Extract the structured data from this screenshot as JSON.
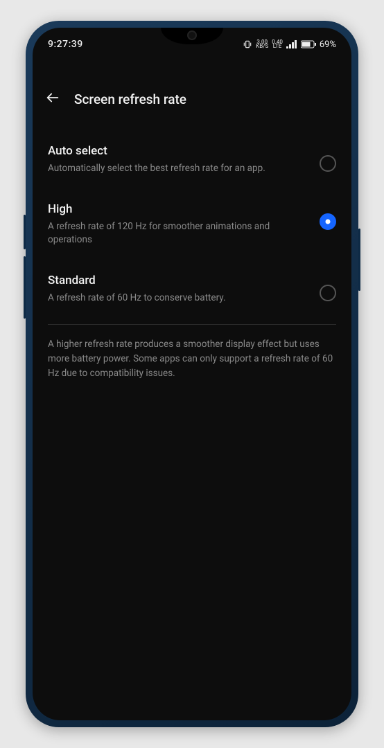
{
  "status": {
    "time": "9:27:39",
    "data_rate_value": "3.00",
    "data_rate_unit": "KB/S",
    "net_hint_top": "0.40",
    "net_hint_bottom": "LTE",
    "battery_pct": "69%"
  },
  "header": {
    "title": "Screen refresh rate"
  },
  "options": [
    {
      "id": "auto",
      "title": "Auto select",
      "desc": "Automatically select the best refresh rate for an app.",
      "selected": false
    },
    {
      "id": "high",
      "title": "High",
      "desc": "A refresh rate of 120 Hz for smoother animations and operations",
      "selected": true
    },
    {
      "id": "standard",
      "title": "Standard",
      "desc": "A refresh rate of 60 Hz to conserve battery.",
      "selected": false
    }
  ],
  "footer_note": "A higher refresh rate produces a smoother display effect but uses more battery power. Some apps can only support a refresh rate of 60 Hz due to compatibility issues."
}
